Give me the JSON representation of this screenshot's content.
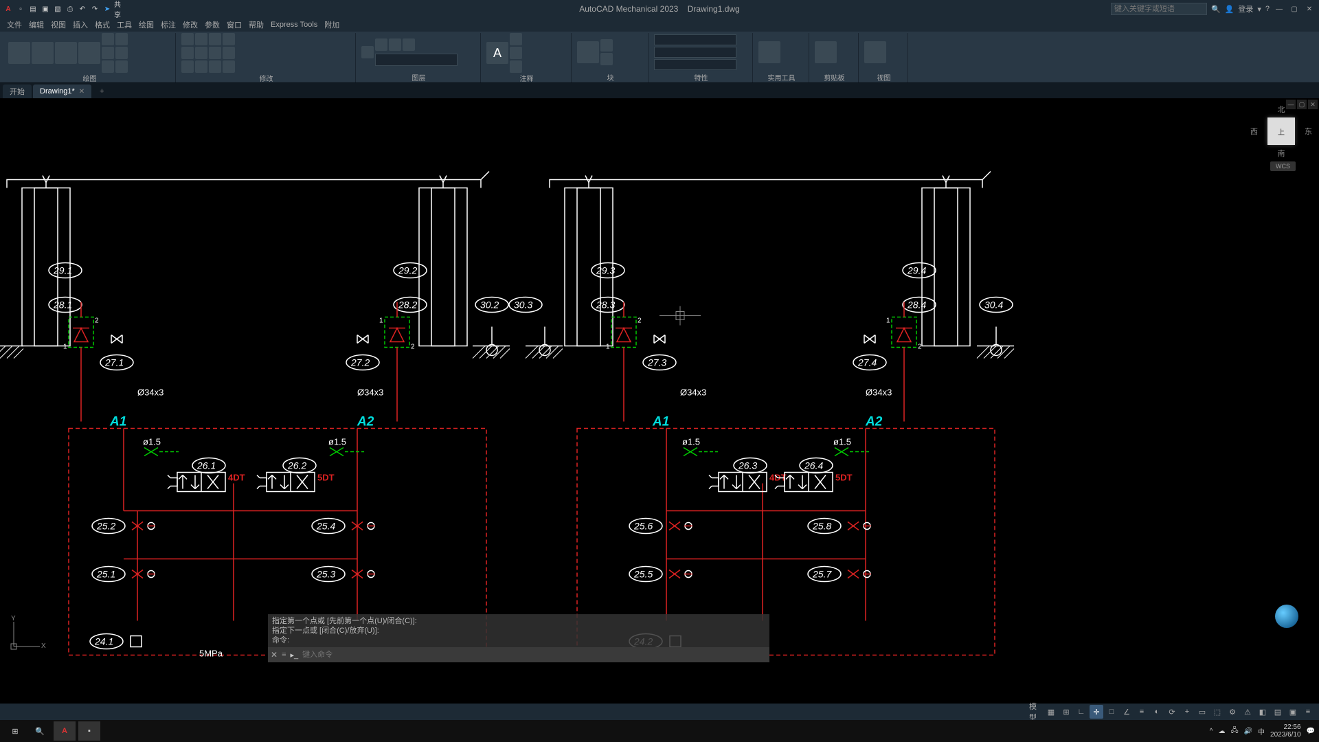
{
  "app": {
    "title_app": "AutoCAD Mechanical 2023",
    "title_doc": "Drawing1.dwg",
    "share": "共享",
    "search_placeholder": "键入关键字或短语",
    "user": "登录"
  },
  "menus": [
    "文件",
    "编辑",
    "视图",
    "插入",
    "格式",
    "工具",
    "绘图",
    "标注",
    "修改",
    "参数",
    "窗口",
    "帮助",
    "Express Tools",
    "附加"
  ],
  "ribbon_panels": [
    "绘图",
    "修改",
    "图层",
    "注释",
    "块",
    "特性",
    "实用工具",
    "剪贴板",
    "视图"
  ],
  "filetabs": {
    "start": "开始",
    "active": "Drawing1*",
    "plus": "+"
  },
  "viewcube": {
    "n": "北",
    "s": "南",
    "e": "东",
    "w": "西",
    "top": "上",
    "wcs": "WCS"
  },
  "cmd": {
    "hist1": "指定第一个点或 [先前第一个点(U)/闭合(C)]:",
    "hist2": "指定下一点或 [闭合(C)/放弃(U)]:",
    "hist3": "命令:",
    "prompt": "键入命令"
  },
  "status_left": "模型",
  "tray": {
    "ime": "中",
    "time": "22:56",
    "date": "2023/6/10"
  },
  "drawing": {
    "dia": "Ø34x3",
    "orif": "ø1.5",
    "press": "5MPa",
    "sol4": "4DT",
    "sol5": "5DT",
    "portA1": "A1",
    "portA2": "A2",
    "tags": {
      "t291": "29.1",
      "t292": "29.2",
      "t293": "29.3",
      "t294": "29.4",
      "t281": "28.1",
      "t282": "28.2",
      "t283": "28.3",
      "t284": "28.4",
      "t302": "30.2",
      "t303": "30.3",
      "t304": "30.4",
      "t271": "27.1",
      "t272": "27.2",
      "t273": "27.3",
      "t274": "27.4",
      "t261": "26.1",
      "t262": "26.2",
      "t263": "26.3",
      "t264": "26.4",
      "t251": "25.1",
      "t252": "25.2",
      "t253": "25.3",
      "t254": "25.4",
      "t255": "25.5",
      "t256": "25.6",
      "t257": "25.7",
      "t258": "25.8",
      "t241": "24.1",
      "t242": "24.2"
    },
    "pnum": {
      "p1": "1",
      "p2": "2"
    }
  }
}
